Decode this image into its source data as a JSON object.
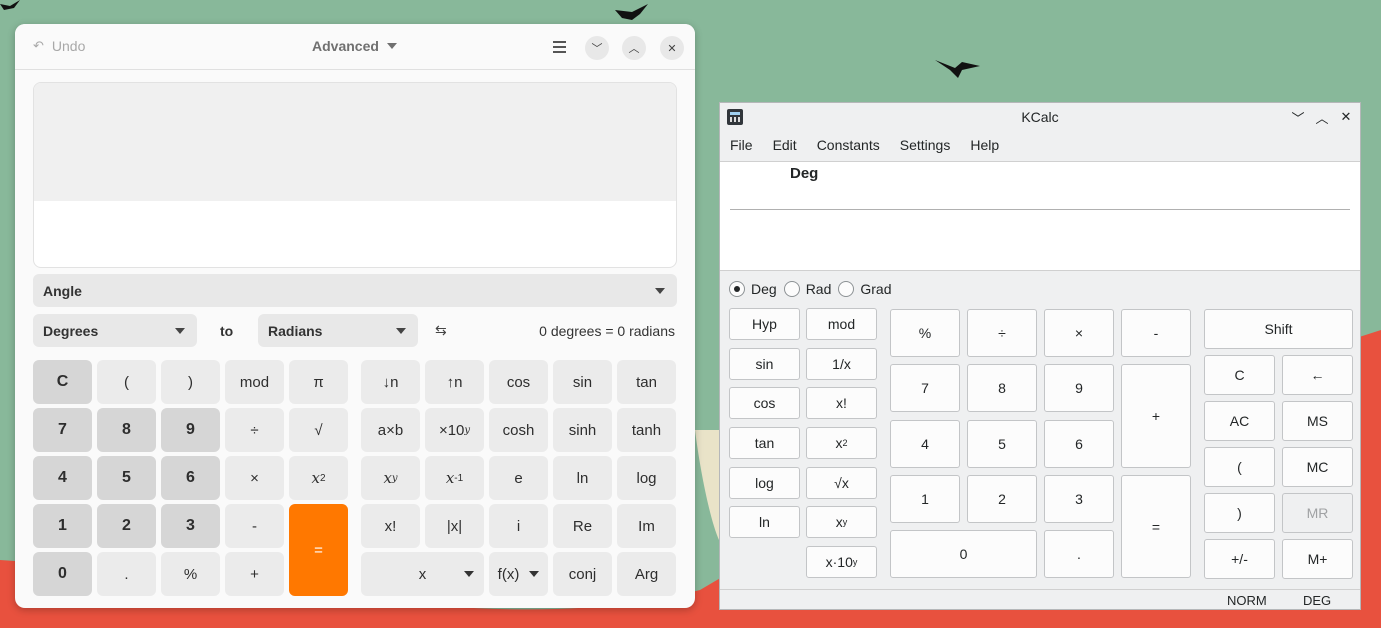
{
  "gnome_calculator": {
    "header": {
      "undo_label": "Undo",
      "mode_label": "Advanced"
    },
    "angle_label": "Angle",
    "from_unit": "Degrees",
    "to_label": "to",
    "to_unit": "Radians",
    "swap_icon": "⇆",
    "result_text": "0 degrees  =  0 radians",
    "keypad": {
      "c": "C",
      "lparen": "(",
      "rparen": ")",
      "mod": "mod",
      "pi": "π",
      "d7": "7",
      "d8": "8",
      "d9": "9",
      "div": "÷",
      "sqrt": "√",
      "d4": "4",
      "d5": "5",
      "d6": "6",
      "mul": "×",
      "d1": "1",
      "d2": "2",
      "d3": "3",
      "sub": "-",
      "eq": "=",
      "d0": "0",
      "dot": ".",
      "pct": "%",
      "add": "+"
    },
    "fn": {
      "down_n": "↓n",
      "up_n": "↑n",
      "cos": "cos",
      "sin": "sin",
      "tan": "tan",
      "axb": "a×b",
      "exp10": "×10",
      "exp10_sup": "y",
      "cosh": "cosh",
      "sinh": "sinh",
      "tanh": "tanh",
      "xy": "x",
      "xy_sup": "y",
      "xinv": "x",
      "xinv_sup": "-1",
      "e": "e",
      "ln": "ln",
      "log": "log",
      "fact": "x!",
      "abs": "|x|",
      "i": "i",
      "re": "Re",
      "im": "Im",
      "var_x": "x",
      "fx": "f(x)",
      "conj": "conj",
      "arg": "Arg",
      "sq": "x",
      "sq_sup": "2"
    }
  },
  "kcalc": {
    "title": "KCalc",
    "menus": [
      "File",
      "Edit",
      "Constants",
      "Settings",
      "Help"
    ],
    "display_mode": "Deg",
    "angle_modes": [
      {
        "label": "Deg",
        "selected": true
      },
      {
        "label": "Rad",
        "selected": false
      },
      {
        "label": "Grad",
        "selected": false
      }
    ],
    "func": {
      "hyp": "Hyp",
      "mod": "mod",
      "sin": "sin",
      "inv": "1/x",
      "cos": "cos",
      "fact": "x!",
      "tan": "tan",
      "sq": "x",
      "sq_sup": "2",
      "log": "log",
      "sqrt": "√x",
      "ln": "ln",
      "pow": "x",
      "pow_sup": "y",
      "exp": "x·10",
      "exp_sup": "y"
    },
    "num": {
      "pct": "%",
      "div": "÷",
      "mul": "×",
      "sub": "-",
      "d7": "7",
      "d8": "8",
      "d9": "9",
      "add": "+",
      "d4": "4",
      "d5": "5",
      "d6": "6",
      "d1": "1",
      "d2": "2",
      "d3": "3",
      "eq": "=",
      "d0": "0",
      "dot": "."
    },
    "ctrl": {
      "shift": "Shift",
      "c": "C",
      "back": "←",
      "ac": "AC",
      "ms": "MS",
      "lparen": "(",
      "mc": "MC",
      "rparen": ")",
      "mr": "MR",
      "neg": "+/-",
      "mplus": "M+"
    },
    "status": {
      "norm": "NORM",
      "deg": "DEG"
    }
  },
  "colors": {
    "accent_orange": "#ff7800",
    "wallpaper_green": "#88b89a",
    "wallpaper_red": "#e8513e"
  }
}
